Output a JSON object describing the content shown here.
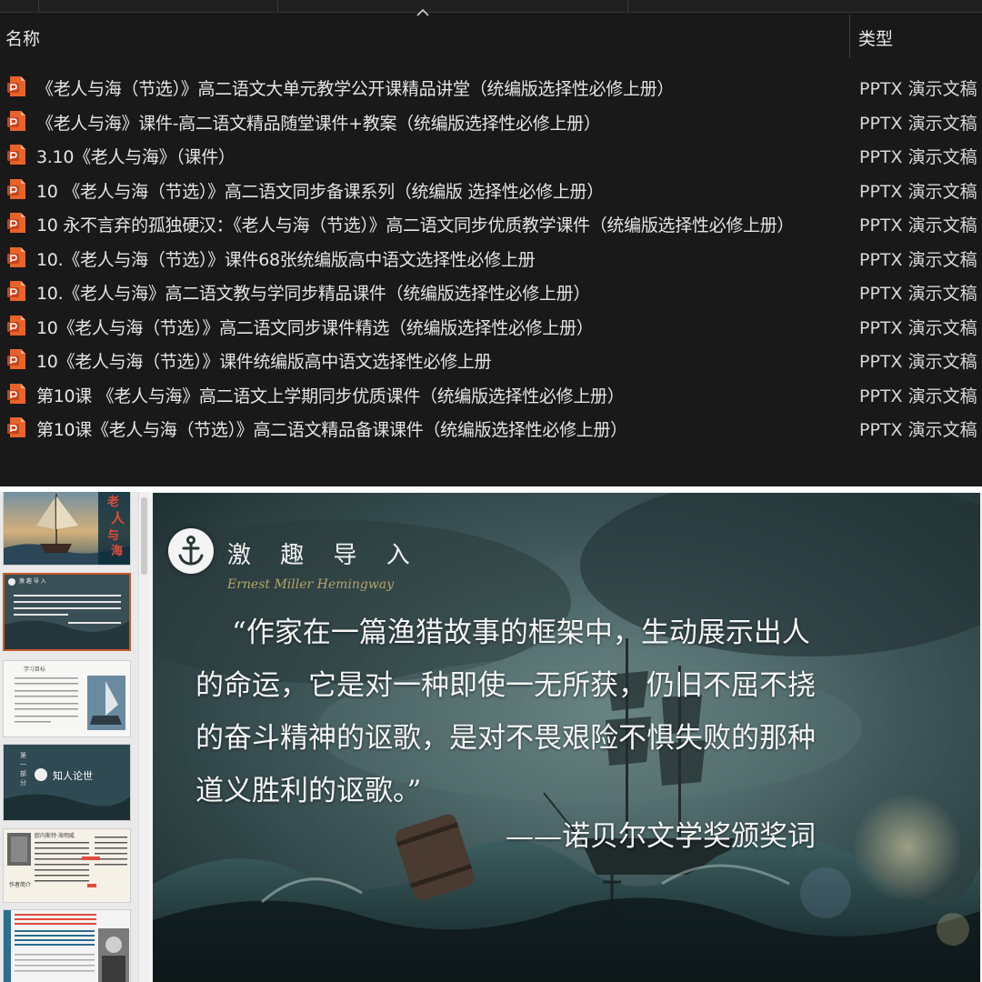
{
  "explorer": {
    "columns": {
      "name": "名称",
      "type": "类型"
    },
    "icon": "pptx-file-icon",
    "files": [
      {
        "name": "《老人与海（节选）》高二语文大单元教学公开课精品讲堂（统编版选择性必修上册）",
        "type": "PPTX 演示文稿"
      },
      {
        "name": "《老人与海》课件-高二语文精品随堂课件+教案（统编版选择性必修上册）",
        "type": "PPTX 演示文稿"
      },
      {
        "name": "3.10《老人与海》（课件）",
        "type": "PPTX 演示文稿"
      },
      {
        "name": "10 《老人与海（节选）》高二语文同步备课系列（统编版 选择性必修上册）",
        "type": "PPTX 演示文稿"
      },
      {
        "name": "10 永不言弃的孤独硬汉：《老人与海（节选）》高二语文同步优质教学课件（统编版选择性必修上册）",
        "type": "PPTX 演示文稿"
      },
      {
        "name": "10.《老人与海（节选）》课件68张统编版高中语文选择性必修上册",
        "type": "PPTX 演示文稿"
      },
      {
        "name": "10.《老人与海》高二语文教与学同步精品课件（统编版选择性必修上册）",
        "type": "PPTX 演示文稿"
      },
      {
        "name": "10《老人与海（节选）》高二语文同步课件精选（统编版选择性必修上册）",
        "type": "PPTX 演示文稿"
      },
      {
        "name": "10《老人与海（节选）》课件统编版高中语文选择性必修上册",
        "type": "PPTX 演示文稿"
      },
      {
        "name": "第10课 《老人与海》高二语文上学期同步优质课件（统编版选择性必修上册）",
        "type": "PPTX 演示文稿"
      },
      {
        "name": "第10课《老人与海（节选）》高二语文精品备课课件（统编版选择性必修上册）",
        "type": "PPTX 演示文稿"
      }
    ]
  },
  "slide": {
    "heading": "激 趣 导 入",
    "subheading": "Ernest Miller Hemingway",
    "quote_lines": [
      "“作家在一篇渔猎故事的框架中，生动展示出人",
      "的命运，它是对一种即使一无所获，仍旧不屈不挠",
      "的奋斗精神的讴歌，是对不畏艰险不惧失败的那种",
      "道义胜利的讴歌。”"
    ],
    "attribution": "——诺贝尔文学奖颁奖词"
  },
  "thumbnails": {
    "t1_title": [
      "老",
      "人",
      "与",
      "海"
    ],
    "t2_heading": "激 趣 导 入",
    "t3_heading": "学习目标",
    "t4_section": "知人论世",
    "t4_vertical": [
      "第",
      "一",
      "部",
      "分"
    ],
    "t5_label": "作者简介",
    "t5_name": "欧内斯特·海明威"
  },
  "colors": {
    "explorer_bg": "#191919",
    "pptx_icon": "#e8632a",
    "selection_border": "#c55a2a",
    "slide_subheading": "#b4a468"
  }
}
